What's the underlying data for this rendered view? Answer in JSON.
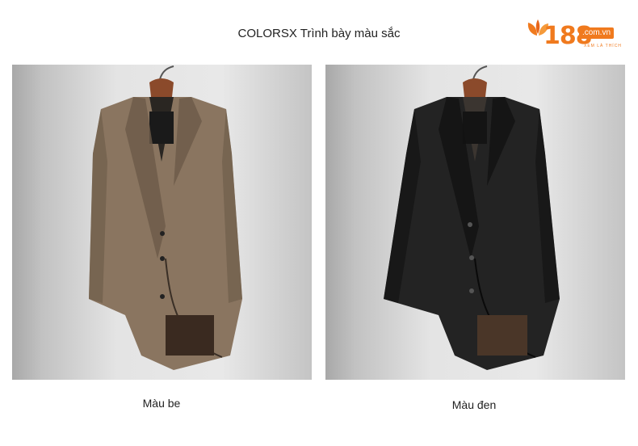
{
  "header": {
    "title": "COLORSX Trình bày màu sắc"
  },
  "logo": {
    "number": "188",
    "domain": ".com.vn",
    "tagline": "XEM LÀ THÍCH",
    "color": "#f07a1e"
  },
  "products": [
    {
      "label": "Màu be",
      "coat_color": "#8a7560",
      "coat_shade": "#6b5a48"
    },
    {
      "label": "Màu đen",
      "coat_color": "#232323",
      "coat_shade": "#111111"
    }
  ]
}
